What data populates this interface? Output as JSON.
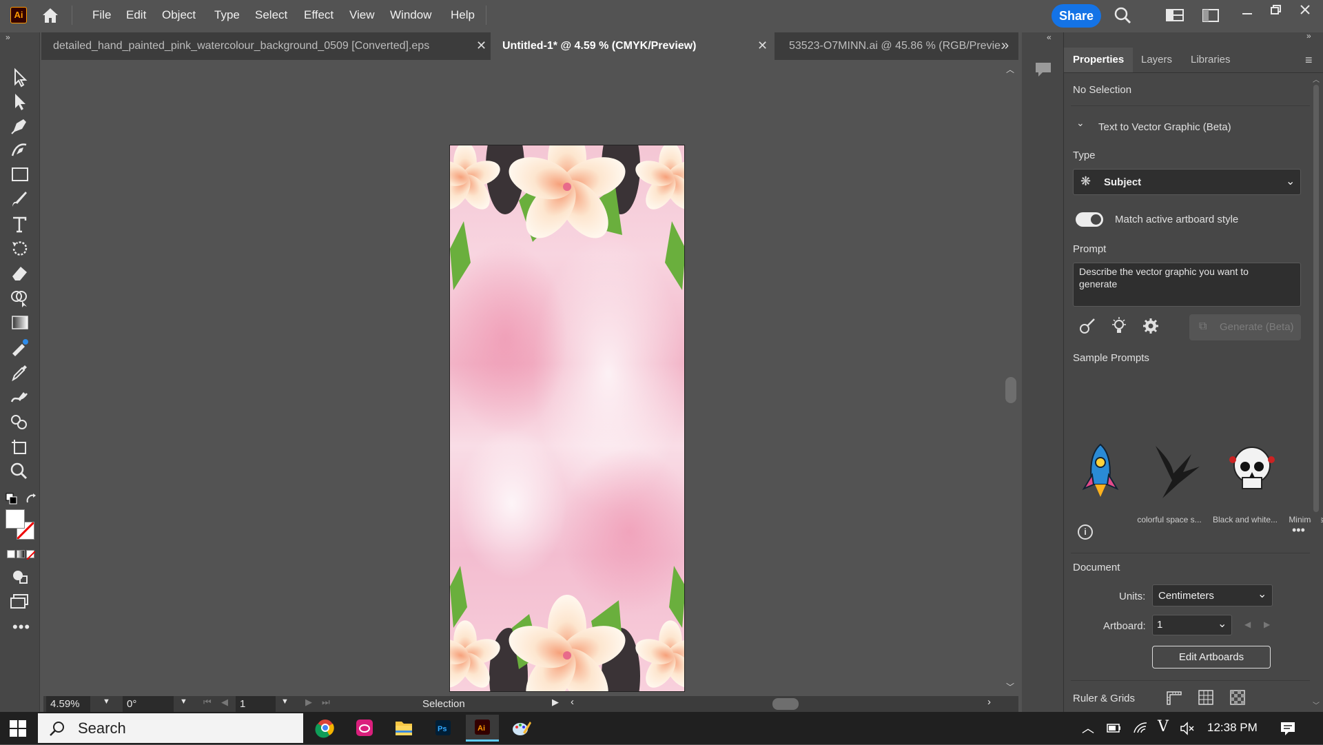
{
  "app": {
    "logo": "Ai",
    "name": "Adobe Illustrator"
  },
  "menu": [
    "File",
    "Edit",
    "Object",
    "Type",
    "Select",
    "Effect",
    "View",
    "Window",
    "Help"
  ],
  "top_right": {
    "share_label": "Share"
  },
  "tabs": [
    {
      "label": "detailed_hand_painted_pink_watercolour_background_0509 [Converted].eps",
      "active": false
    },
    {
      "label": "Untitled-1* @ 4.59 % (CMYK/Preview)",
      "active": true
    },
    {
      "label": "53523-O7MINN.ai @ 45.86 % (RGB/Previe...",
      "active": false
    }
  ],
  "status": {
    "zoom": "4.59%",
    "rotation": "0°",
    "artboard_num": "1",
    "tool_name": "Selection"
  },
  "panel": {
    "tabs": [
      "Properties",
      "Layers",
      "Libraries"
    ],
    "selection": "No Selection",
    "section_title": "Text to Vector Graphic (Beta)",
    "type_label": "Type",
    "type_value": "Subject",
    "toggle_label": "Match active artboard style",
    "toggle_on": true,
    "prompt_label": "Prompt",
    "prompt_placeholder": "Describe the vector graphic you want to generate",
    "generate_label": "Generate (Beta)",
    "sample_title": "Sample Prompts",
    "samples": [
      "colorful space s...",
      "Black and white...",
      "Minimal skull wi..."
    ],
    "document_label": "Document",
    "units_label": "Units:",
    "units_value": "Centimeters",
    "artboard_label": "Artboard:",
    "artboard_value": "1",
    "edit_artboards_label": "Edit Artboards",
    "ruler_label": "Ruler & Grids"
  },
  "taskbar": {
    "search_placeholder": "Search",
    "time": "12:38 PM",
    "apps": [
      "chrome-icon",
      "creative-cloud-icon",
      "file-explorer-icon",
      "photoshop-icon",
      "illustrator-icon",
      "paint-icon"
    ]
  },
  "colors": {
    "accent": "#1473e6",
    "illustrator_orange": "#ff9a00",
    "artboard_pink": "#f4c6d4"
  }
}
